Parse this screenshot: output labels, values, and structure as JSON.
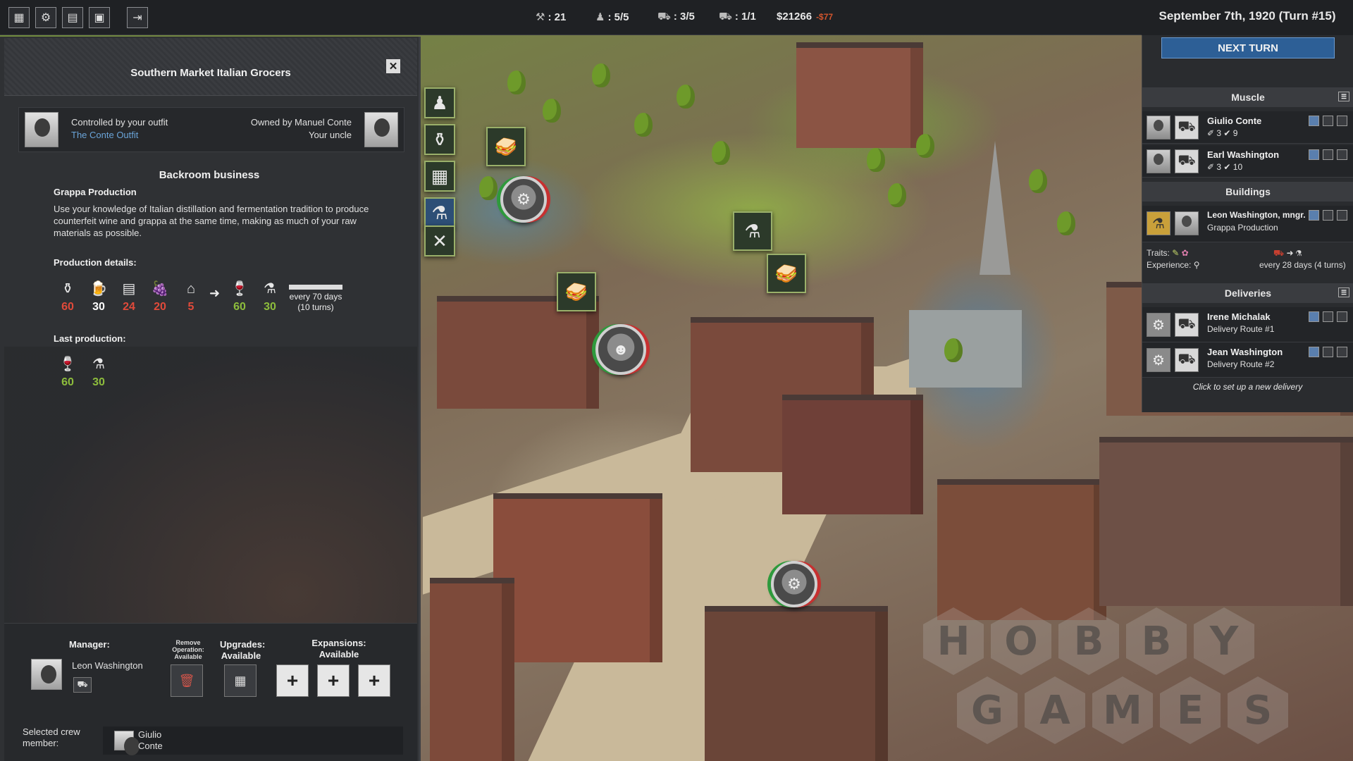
{
  "topbar": {
    "icons": [
      "map-filter-icon",
      "map-settings-icon",
      "ledger-icon",
      "save-icon",
      "exit-icon"
    ],
    "resources": [
      {
        "icon": "heat-icon",
        "glyph": "⚒",
        "value": ": 21"
      },
      {
        "icon": "crew-icon",
        "glyph": "♟",
        "value": ": 5/5"
      },
      {
        "icon": "truck-icon",
        "glyph": "⛟",
        "value": ": 3/5"
      },
      {
        "icon": "car-icon",
        "glyph": "⛟",
        "value": ": 1/1"
      }
    ],
    "money": "$21266",
    "money_delta": "-$77"
  },
  "right_panel": {
    "date": "September 7th, 1920 (Turn #15)",
    "next_turn": "NEXT TURN",
    "muscle_header": "Muscle",
    "muscle": [
      {
        "name": "Giulio Conte",
        "stats": "✐ 3  ✔ 9"
      },
      {
        "name": "Earl Washington",
        "stats": "✐ 3  ✔ 10"
      }
    ],
    "buildings_header": "Buildings",
    "building": {
      "name": "Leon Washington, mngr.",
      "operation": "Grappa Production"
    },
    "traits_label": "Traits:",
    "experience_label": "Experience:",
    "every_text": "every 28 days (4 turns)",
    "deliveries_header": "Deliveries",
    "deliveries": [
      {
        "name": "Irene Michalak",
        "route": "Delivery Route #1"
      },
      {
        "name": "Jean Washington",
        "route": "Delivery Route #2"
      }
    ],
    "new_delivery": "Click to set up a new delivery"
  },
  "left_panel": {
    "title": "Southern Market Italian Grocers",
    "controlled_by": "Controlled by your outfit",
    "outfit": "The Conte Outfit",
    "owned_by": "Owned by Manuel Conte",
    "relation": "Your uncle",
    "section": "Backroom business",
    "operation_title": "Grappa Production",
    "description": "Use your knowledge of Italian distillation and fermentation tradition to produce counterfeit wine and grappa at the same time, making as much of your raw materials as possible.",
    "production_head": "Production details:",
    "inputs": [
      {
        "icon": "moonshine-icon",
        "glyph": "⚱",
        "value": "60",
        "color": "red"
      },
      {
        "icon": "beer-icon",
        "glyph": "🍺",
        "value": "30",
        "color": "white"
      },
      {
        "icon": "sugar-icon",
        "glyph": "▤",
        "value": "24",
        "color": "red"
      },
      {
        "icon": "grapes-icon",
        "glyph": "🍇",
        "value": "20",
        "color": "red"
      },
      {
        "icon": "yeast-icon",
        "glyph": "⌂",
        "value": "5",
        "color": "red"
      }
    ],
    "outputs": [
      {
        "icon": "wine-icon",
        "glyph": "🍷",
        "value": "60",
        "color": "green"
      },
      {
        "icon": "grappa-icon",
        "glyph": "⚗",
        "value": "30",
        "color": "green"
      }
    ],
    "progress": 1.0,
    "every": "every 70 days\n(10 turns)",
    "last_head": "Last production:",
    "last": [
      {
        "icon": "wine-icon",
        "glyph": "🍷",
        "value": "60"
      },
      {
        "icon": "grappa-icon",
        "glyph": "⚗",
        "value": "30"
      }
    ],
    "footer": {
      "manager_label": "Manager:",
      "manager_name": "Leon Washington",
      "remove_label": "Remove Operation: Available",
      "upgrades_label": "Upgrades:",
      "upgrades_status": "Available",
      "expansions_label": "Expansions:",
      "expansions_status": "Available",
      "crew_label": "Selected crew member:",
      "crew_name": "Giulio Conte"
    }
  },
  "watermark": [
    "H",
    "O",
    "B",
    "B",
    "Y",
    "G",
    "A",
    "M",
    "E",
    "S"
  ]
}
